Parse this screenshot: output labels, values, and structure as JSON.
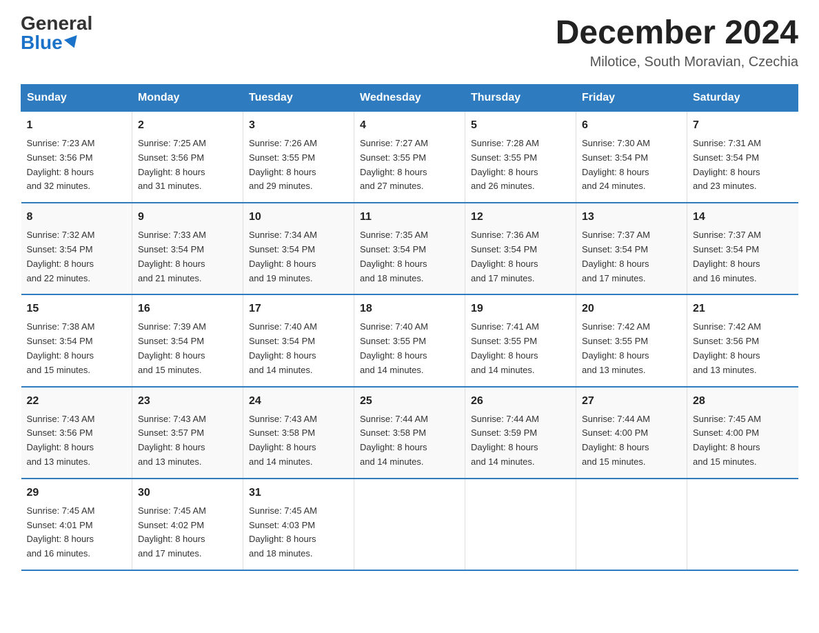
{
  "header": {
    "logo_general": "General",
    "logo_blue": "Blue",
    "month_title": "December 2024",
    "location": "Milotice, South Moravian, Czechia"
  },
  "days_of_week": [
    "Sunday",
    "Monday",
    "Tuesday",
    "Wednesday",
    "Thursday",
    "Friday",
    "Saturday"
  ],
  "weeks": [
    [
      {
        "day": "1",
        "sunrise": "7:23 AM",
        "sunset": "3:56 PM",
        "daylight": "8 hours and 32 minutes."
      },
      {
        "day": "2",
        "sunrise": "7:25 AM",
        "sunset": "3:56 PM",
        "daylight": "8 hours and 31 minutes."
      },
      {
        "day": "3",
        "sunrise": "7:26 AM",
        "sunset": "3:55 PM",
        "daylight": "8 hours and 29 minutes."
      },
      {
        "day": "4",
        "sunrise": "7:27 AM",
        "sunset": "3:55 PM",
        "daylight": "8 hours and 27 minutes."
      },
      {
        "day": "5",
        "sunrise": "7:28 AM",
        "sunset": "3:55 PM",
        "daylight": "8 hours and 26 minutes."
      },
      {
        "day": "6",
        "sunrise": "7:30 AM",
        "sunset": "3:54 PM",
        "daylight": "8 hours and 24 minutes."
      },
      {
        "day": "7",
        "sunrise": "7:31 AM",
        "sunset": "3:54 PM",
        "daylight": "8 hours and 23 minutes."
      }
    ],
    [
      {
        "day": "8",
        "sunrise": "7:32 AM",
        "sunset": "3:54 PM",
        "daylight": "8 hours and 22 minutes."
      },
      {
        "day": "9",
        "sunrise": "7:33 AM",
        "sunset": "3:54 PM",
        "daylight": "8 hours and 21 minutes."
      },
      {
        "day": "10",
        "sunrise": "7:34 AM",
        "sunset": "3:54 PM",
        "daylight": "8 hours and 19 minutes."
      },
      {
        "day": "11",
        "sunrise": "7:35 AM",
        "sunset": "3:54 PM",
        "daylight": "8 hours and 18 minutes."
      },
      {
        "day": "12",
        "sunrise": "7:36 AM",
        "sunset": "3:54 PM",
        "daylight": "8 hours and 17 minutes."
      },
      {
        "day": "13",
        "sunrise": "7:37 AM",
        "sunset": "3:54 PM",
        "daylight": "8 hours and 17 minutes."
      },
      {
        "day": "14",
        "sunrise": "7:37 AM",
        "sunset": "3:54 PM",
        "daylight": "8 hours and 16 minutes."
      }
    ],
    [
      {
        "day": "15",
        "sunrise": "7:38 AM",
        "sunset": "3:54 PM",
        "daylight": "8 hours and 15 minutes."
      },
      {
        "day": "16",
        "sunrise": "7:39 AM",
        "sunset": "3:54 PM",
        "daylight": "8 hours and 15 minutes."
      },
      {
        "day": "17",
        "sunrise": "7:40 AM",
        "sunset": "3:54 PM",
        "daylight": "8 hours and 14 minutes."
      },
      {
        "day": "18",
        "sunrise": "7:40 AM",
        "sunset": "3:55 PM",
        "daylight": "8 hours and 14 minutes."
      },
      {
        "day": "19",
        "sunrise": "7:41 AM",
        "sunset": "3:55 PM",
        "daylight": "8 hours and 14 minutes."
      },
      {
        "day": "20",
        "sunrise": "7:42 AM",
        "sunset": "3:55 PM",
        "daylight": "8 hours and 13 minutes."
      },
      {
        "day": "21",
        "sunrise": "7:42 AM",
        "sunset": "3:56 PM",
        "daylight": "8 hours and 13 minutes."
      }
    ],
    [
      {
        "day": "22",
        "sunrise": "7:43 AM",
        "sunset": "3:56 PM",
        "daylight": "8 hours and 13 minutes."
      },
      {
        "day": "23",
        "sunrise": "7:43 AM",
        "sunset": "3:57 PM",
        "daylight": "8 hours and 13 minutes."
      },
      {
        "day": "24",
        "sunrise": "7:43 AM",
        "sunset": "3:58 PM",
        "daylight": "8 hours and 14 minutes."
      },
      {
        "day": "25",
        "sunrise": "7:44 AM",
        "sunset": "3:58 PM",
        "daylight": "8 hours and 14 minutes."
      },
      {
        "day": "26",
        "sunrise": "7:44 AM",
        "sunset": "3:59 PM",
        "daylight": "8 hours and 14 minutes."
      },
      {
        "day": "27",
        "sunrise": "7:44 AM",
        "sunset": "4:00 PM",
        "daylight": "8 hours and 15 minutes."
      },
      {
        "day": "28",
        "sunrise": "7:45 AM",
        "sunset": "4:00 PM",
        "daylight": "8 hours and 15 minutes."
      }
    ],
    [
      {
        "day": "29",
        "sunrise": "7:45 AM",
        "sunset": "4:01 PM",
        "daylight": "8 hours and 16 minutes."
      },
      {
        "day": "30",
        "sunrise": "7:45 AM",
        "sunset": "4:02 PM",
        "daylight": "8 hours and 17 minutes."
      },
      {
        "day": "31",
        "sunrise": "7:45 AM",
        "sunset": "4:03 PM",
        "daylight": "8 hours and 18 minutes."
      },
      {
        "day": "",
        "sunrise": "",
        "sunset": "",
        "daylight": ""
      },
      {
        "day": "",
        "sunrise": "",
        "sunset": "",
        "daylight": ""
      },
      {
        "day": "",
        "sunrise": "",
        "sunset": "",
        "daylight": ""
      },
      {
        "day": "",
        "sunrise": "",
        "sunset": "",
        "daylight": ""
      }
    ]
  ],
  "labels": {
    "sunrise": "Sunrise:",
    "sunset": "Sunset:",
    "daylight": "Daylight:"
  }
}
